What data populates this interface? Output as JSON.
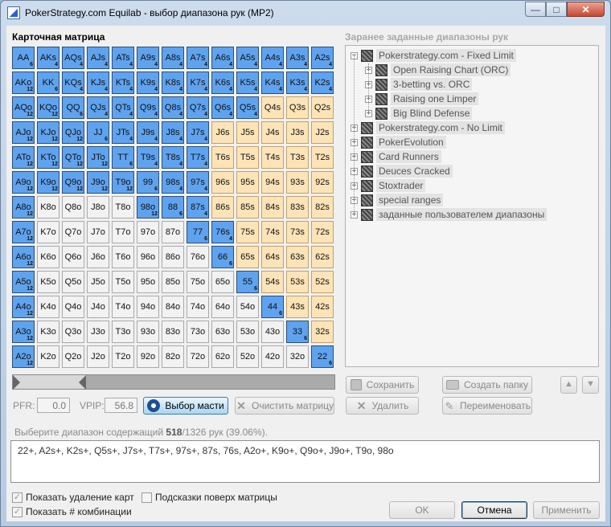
{
  "window": {
    "title": "PokerStrategy.com Equilab - выбор диапазона рук (MP2)",
    "minimize": "—",
    "maximize": "□",
    "close": "✕"
  },
  "matrix": {
    "title": "Карточная матрица",
    "rows": [
      [
        [
          "AA",
          "sel",
          "6"
        ],
        [
          "AKs",
          "sel",
          "4"
        ],
        [
          "AQs",
          "sel",
          "4"
        ],
        [
          "AJs",
          "sel",
          "4"
        ],
        [
          "ATs",
          "sel",
          "4"
        ],
        [
          "A9s",
          "sel",
          "4"
        ],
        [
          "A8s",
          "sel",
          "4"
        ],
        [
          "A7s",
          "sel",
          "4"
        ],
        [
          "A6s",
          "sel",
          "4"
        ],
        [
          "A5s",
          "sel",
          "4"
        ],
        [
          "A4s",
          "sel",
          "4"
        ],
        [
          "A3s",
          "sel",
          "4"
        ],
        [
          "A2s",
          "sel",
          "4"
        ]
      ],
      [
        [
          "AKo",
          "sel",
          "12"
        ],
        [
          "KK",
          "sel",
          "6"
        ],
        [
          "KQs",
          "sel",
          "4"
        ],
        [
          "KJs",
          "sel",
          "4"
        ],
        [
          "KTs",
          "sel",
          "4"
        ],
        [
          "K9s",
          "sel",
          "4"
        ],
        [
          "K8s",
          "sel",
          "4"
        ],
        [
          "K7s",
          "sel",
          "4"
        ],
        [
          "K6s",
          "sel",
          "4"
        ],
        [
          "K5s",
          "sel",
          "4"
        ],
        [
          "K4s",
          "sel",
          "4"
        ],
        [
          "K3s",
          "sel",
          "4"
        ],
        [
          "K2s",
          "sel",
          "4"
        ]
      ],
      [
        [
          "AQo",
          "sel",
          "12"
        ],
        [
          "KQo",
          "sel",
          "12"
        ],
        [
          "QQ",
          "sel",
          "6"
        ],
        [
          "QJs",
          "sel",
          "4"
        ],
        [
          "QTs",
          "sel",
          "4"
        ],
        [
          "Q9s",
          "sel",
          "4"
        ],
        [
          "Q8s",
          "sel",
          "4"
        ],
        [
          "Q7s",
          "sel",
          "4"
        ],
        [
          "Q6s",
          "sel",
          "4"
        ],
        [
          "Q5s",
          "sel",
          "4"
        ],
        [
          "Q4s",
          "sug",
          ""
        ],
        [
          "Q3s",
          "sug",
          ""
        ],
        [
          "Q2s",
          "sug",
          ""
        ]
      ],
      [
        [
          "AJo",
          "sel",
          "12"
        ],
        [
          "KJo",
          "sel",
          "12"
        ],
        [
          "QJo",
          "sel",
          "12"
        ],
        [
          "JJ",
          "sel",
          "6"
        ],
        [
          "JTs",
          "sel",
          "4"
        ],
        [
          "J9s",
          "sel",
          "4"
        ],
        [
          "J8s",
          "sel",
          "4"
        ],
        [
          "J7s",
          "sel",
          "4"
        ],
        [
          "J6s",
          "sug",
          ""
        ],
        [
          "J5s",
          "sug",
          ""
        ],
        [
          "J4s",
          "sug",
          ""
        ],
        [
          "J3s",
          "sug",
          ""
        ],
        [
          "J2s",
          "sug",
          ""
        ]
      ],
      [
        [
          "ATo",
          "sel",
          "12"
        ],
        [
          "KTo",
          "sel",
          "12"
        ],
        [
          "QTo",
          "sel",
          "12"
        ],
        [
          "JTo",
          "sel",
          "12"
        ],
        [
          "TT",
          "sel",
          "6"
        ],
        [
          "T9s",
          "sel",
          "4"
        ],
        [
          "T8s",
          "sel",
          "4"
        ],
        [
          "T7s",
          "sel",
          "4"
        ],
        [
          "T6s",
          "sug",
          ""
        ],
        [
          "T5s",
          "sug",
          ""
        ],
        [
          "T4s",
          "sug",
          ""
        ],
        [
          "T3s",
          "sug",
          ""
        ],
        [
          "T2s",
          "sug",
          ""
        ]
      ],
      [
        [
          "A9o",
          "sel",
          "12"
        ],
        [
          "K9o",
          "sel",
          "12"
        ],
        [
          "Q9o",
          "sel",
          "12"
        ],
        [
          "J9o",
          "sel",
          "12"
        ],
        [
          "T9o",
          "sel",
          "12"
        ],
        [
          "99",
          "sel",
          "6"
        ],
        [
          "98s",
          "sel",
          "4"
        ],
        [
          "97s",
          "sel",
          "4"
        ],
        [
          "96s",
          "sug",
          ""
        ],
        [
          "95s",
          "sug",
          ""
        ],
        [
          "94s",
          "sug",
          ""
        ],
        [
          "93s",
          "sug",
          ""
        ],
        [
          "92s",
          "sug",
          ""
        ]
      ],
      [
        [
          "A8o",
          "sel",
          "12"
        ],
        [
          "K8o",
          "no",
          ""
        ],
        [
          "Q8o",
          "no",
          ""
        ],
        [
          "J8o",
          "no",
          ""
        ],
        [
          "T8o",
          "no",
          ""
        ],
        [
          "98o",
          "sel",
          "12"
        ],
        [
          "88",
          "sel",
          "6"
        ],
        [
          "87s",
          "sel",
          "4"
        ],
        [
          "86s",
          "sug",
          ""
        ],
        [
          "85s",
          "sug",
          ""
        ],
        [
          "84s",
          "sug",
          ""
        ],
        [
          "83s",
          "sug",
          ""
        ],
        [
          "82s",
          "sug",
          ""
        ]
      ],
      [
        [
          "A7o",
          "sel",
          "12"
        ],
        [
          "K7o",
          "no",
          ""
        ],
        [
          "Q7o",
          "no",
          ""
        ],
        [
          "J7o",
          "no",
          ""
        ],
        [
          "T7o",
          "no",
          ""
        ],
        [
          "97o",
          "no",
          ""
        ],
        [
          "87o",
          "no",
          ""
        ],
        [
          "77",
          "sel",
          "6"
        ],
        [
          "76s",
          "sel",
          "4"
        ],
        [
          "75s",
          "sug",
          ""
        ],
        [
          "74s",
          "sug",
          ""
        ],
        [
          "73s",
          "sug",
          ""
        ],
        [
          "72s",
          "sug",
          ""
        ]
      ],
      [
        [
          "A6o",
          "sel",
          "12"
        ],
        [
          "K6o",
          "no",
          ""
        ],
        [
          "Q6o",
          "no",
          ""
        ],
        [
          "J6o",
          "no",
          ""
        ],
        [
          "T6o",
          "no",
          ""
        ],
        [
          "96o",
          "no",
          ""
        ],
        [
          "86o",
          "no",
          ""
        ],
        [
          "76o",
          "no",
          ""
        ],
        [
          "66",
          "sel",
          "6"
        ],
        [
          "65s",
          "sug",
          ""
        ],
        [
          "64s",
          "sug",
          ""
        ],
        [
          "63s",
          "sug",
          ""
        ],
        [
          "62s",
          "sug",
          ""
        ]
      ],
      [
        [
          "A5o",
          "sel",
          "12"
        ],
        [
          "K5o",
          "no",
          ""
        ],
        [
          "Q5o",
          "no",
          ""
        ],
        [
          "J5o",
          "no",
          ""
        ],
        [
          "T5o",
          "no",
          ""
        ],
        [
          "95o",
          "no",
          ""
        ],
        [
          "85o",
          "no",
          ""
        ],
        [
          "75o",
          "no",
          ""
        ],
        [
          "65o",
          "no",
          ""
        ],
        [
          "55",
          "sel",
          "6"
        ],
        [
          "54s",
          "sug",
          ""
        ],
        [
          "53s",
          "sug",
          ""
        ],
        [
          "52s",
          "sug",
          ""
        ]
      ],
      [
        [
          "A4o",
          "sel",
          "12"
        ],
        [
          "K4o",
          "no",
          ""
        ],
        [
          "Q4o",
          "no",
          ""
        ],
        [
          "J4o",
          "no",
          ""
        ],
        [
          "T4o",
          "no",
          ""
        ],
        [
          "94o",
          "no",
          ""
        ],
        [
          "84o",
          "no",
          ""
        ],
        [
          "74o",
          "no",
          ""
        ],
        [
          "64o",
          "no",
          ""
        ],
        [
          "54o",
          "no",
          ""
        ],
        [
          "44",
          "sel",
          "6"
        ],
        [
          "43s",
          "sug",
          ""
        ],
        [
          "42s",
          "sug",
          ""
        ]
      ],
      [
        [
          "A3o",
          "sel",
          "12"
        ],
        [
          "K3o",
          "no",
          ""
        ],
        [
          "Q3o",
          "no",
          ""
        ],
        [
          "J3o",
          "no",
          ""
        ],
        [
          "T3o",
          "no",
          ""
        ],
        [
          "93o",
          "no",
          ""
        ],
        [
          "83o",
          "no",
          ""
        ],
        [
          "73o",
          "no",
          ""
        ],
        [
          "63o",
          "no",
          ""
        ],
        [
          "53o",
          "no",
          ""
        ],
        [
          "43o",
          "no",
          ""
        ],
        [
          "33",
          "sel",
          "6"
        ],
        [
          "32s",
          "sug",
          ""
        ]
      ],
      [
        [
          "A2o",
          "sel",
          "12"
        ],
        [
          "K2o",
          "no",
          ""
        ],
        [
          "Q2o",
          "no",
          ""
        ],
        [
          "J2o",
          "no",
          ""
        ],
        [
          "T2o",
          "no",
          ""
        ],
        [
          "92o",
          "no",
          ""
        ],
        [
          "82o",
          "no",
          ""
        ],
        [
          "72o",
          "no",
          ""
        ],
        [
          "62o",
          "no",
          ""
        ],
        [
          "52o",
          "no",
          ""
        ],
        [
          "42o",
          "no",
          ""
        ],
        [
          "32o",
          "no",
          ""
        ],
        [
          "22",
          "sel",
          "6"
        ]
      ]
    ]
  },
  "slider": {
    "value_pct": 39.06
  },
  "stats": {
    "pfr_label": "PFR:",
    "pfr_value": "0.0",
    "vpip_label": "VPIP:",
    "vpip_value": "56.8"
  },
  "buttons": {
    "suit_select": "Выбор масти",
    "clear_matrix": "Очистить матрицу",
    "save": "Сохранить",
    "create_folder": "Создать папку",
    "delete": "Удалить",
    "rename": "Переименовать",
    "ok": "OK",
    "cancel": "Отмена",
    "apply": "Применить",
    "up": "▲",
    "down": "▼"
  },
  "presets": {
    "title": "Заранее заданные диапазоны рук",
    "nodes": [
      {
        "label": "Pokerstrategy.com - Fixed Limit",
        "level": 0,
        "expanded": true
      },
      {
        "label": "Open Raising Chart (ORC)",
        "level": 1,
        "expanded": false
      },
      {
        "label": "3-betting vs. ORC",
        "level": 1,
        "expanded": false
      },
      {
        "label": "Raising one Limper",
        "level": 1,
        "expanded": false
      },
      {
        "label": "Big Blind Defense",
        "level": 1,
        "expanded": false
      },
      {
        "label": "Pokerstrategy.com - No Limit",
        "level": 0,
        "expanded": false
      },
      {
        "label": "PokerEvolution",
        "level": 0,
        "expanded": false
      },
      {
        "label": "Card Runners",
        "level": 0,
        "expanded": false
      },
      {
        "label": "Deuces Cracked",
        "level": 0,
        "expanded": false
      },
      {
        "label": "Stoxtrader",
        "level": 0,
        "expanded": false
      },
      {
        "label": "special ranges",
        "level": 0,
        "expanded": false
      },
      {
        "label": "заданные пользователем диапазоны",
        "level": 0,
        "expanded": false
      }
    ]
  },
  "selection_info": {
    "prefix": "Выберите диапазон содержащий ",
    "count": "518",
    "suffix": "/1326 рук (39.06%)."
  },
  "range_text": "22+, A2s+, K2s+, Q5s+, J7s+, T7s+, 97s+, 87s, 76s, A2o+, K9o+, Q9o+, J9o+, T9o, 98o",
  "checkboxes": {
    "show_removal": "Показать удаление карт",
    "show_hints": "Подсказки поверх матрицы",
    "show_combos": "Показать # комбинации",
    "check_mark": "✓"
  }
}
